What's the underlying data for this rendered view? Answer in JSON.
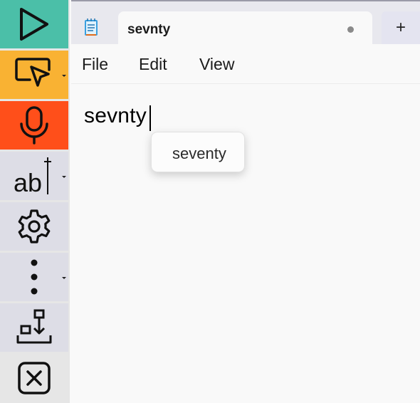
{
  "toolbar": {
    "buttons": [
      {
        "icon": "play-icon",
        "color": "#4bbfa8"
      },
      {
        "icon": "screen-pointer-icon",
        "color": "#f9b233",
        "has_dropdown": true
      },
      {
        "icon": "microphone-icon",
        "color": "#ff4f1a"
      },
      {
        "icon": "text-cursor-ab-icon",
        "color": "#dddde6",
        "has_dropdown": true
      },
      {
        "icon": "gear-icon",
        "color": "#dddde6"
      },
      {
        "icon": "more-vertical-icon",
        "color": "#dddde6",
        "has_dropdown": true
      },
      {
        "icon": "download-tray-icon",
        "color": "#dddde6"
      },
      {
        "icon": "close-box-icon",
        "color": "#e6e6e6"
      }
    ]
  },
  "tabs": [
    {
      "title": "sevnty",
      "unsaved": true
    }
  ],
  "new_tab_label": "+",
  "menu": {
    "file": "File",
    "edit": "Edit",
    "view": "View"
  },
  "document": {
    "text": "sevnty"
  },
  "suggestion": {
    "items": [
      "seventy"
    ]
  }
}
